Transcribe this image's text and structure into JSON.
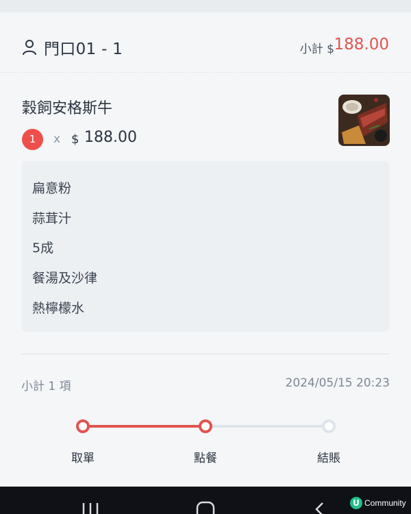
{
  "header": {
    "table_name": "門口01 - 1",
    "subtotal_label": "小計 $",
    "subtotal_value": "188.00"
  },
  "item": {
    "name": "穀飼安格斯牛",
    "quantity": "1",
    "times": "x",
    "currency": "$",
    "price": "188.00",
    "options": [
      "扁意粉",
      "蒜茸汁",
      "5成",
      "餐湯及沙律",
      "熱檸檬水"
    ]
  },
  "summary": {
    "count_label": "小計 1 項",
    "timestamp": "2024/05/15 20:23"
  },
  "progress": {
    "steps": [
      {
        "label": "取單",
        "state": "done"
      },
      {
        "label": "點餐",
        "state": "done"
      },
      {
        "label": "結賬",
        "state": "todo"
      }
    ]
  },
  "watermark": {
    "letter": "U",
    "text": "Community"
  },
  "colors": {
    "accent": "#e0554f",
    "badge": "#ef4f4a",
    "watermark": "#1fbf8a"
  }
}
